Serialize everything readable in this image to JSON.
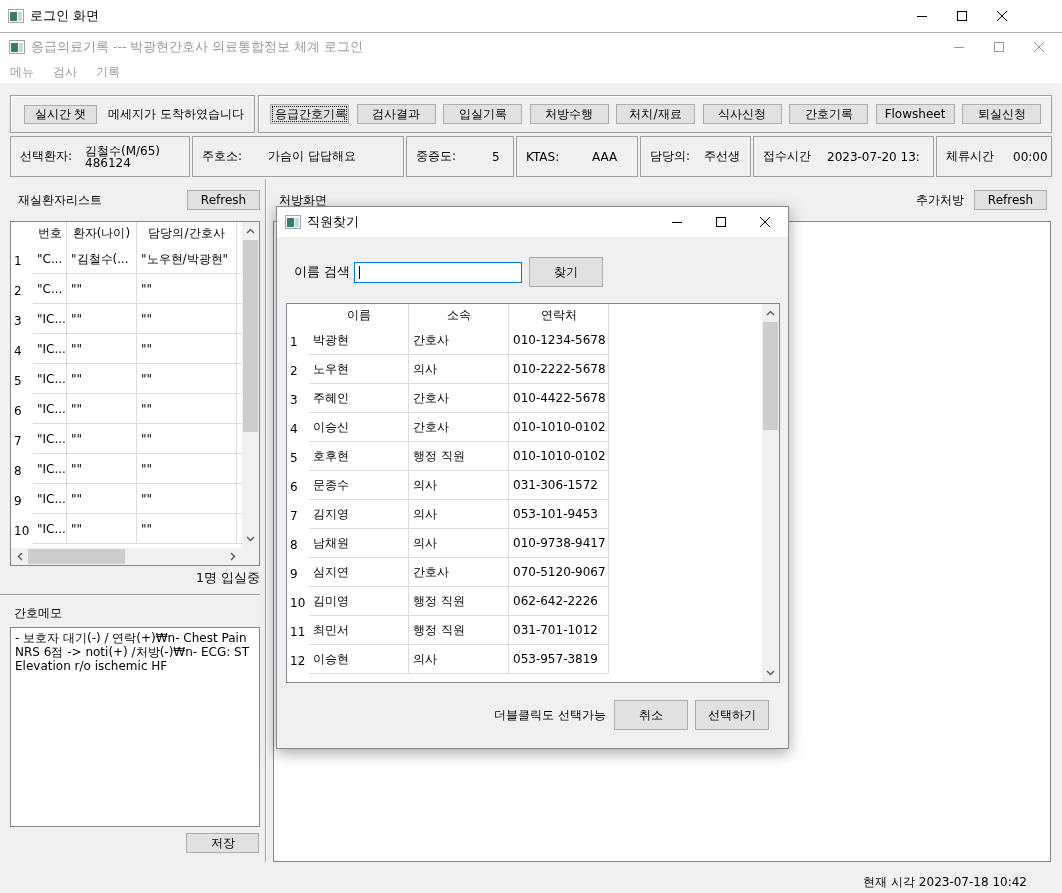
{
  "outer_window": {
    "title": "로그인 화면"
  },
  "window": {
    "title": "응급의료기록 --- 박광현간호사 의료통합정보 체계 로그인"
  },
  "menu": [
    {
      "label": "메뉴"
    },
    {
      "label": "검사"
    },
    {
      "label": "기록"
    }
  ],
  "chat": {
    "button": "실시간 챗",
    "message": "메세지가 도착하였습니다"
  },
  "toolbar": [
    {
      "label": "응급간호기록",
      "focused": true
    },
    {
      "label": "검사결과",
      "focused": false
    },
    {
      "label": "입실기록",
      "focused": false
    },
    {
      "label": "처방수행",
      "focused": false
    },
    {
      "label": "처치/재료",
      "focused": false
    },
    {
      "label": "식사신청",
      "focused": false
    },
    {
      "label": "간호기록",
      "focused": false
    },
    {
      "label": "Flowsheet",
      "focused": false
    },
    {
      "label": "퇴실신청",
      "focused": false
    }
  ],
  "patient_info": [
    {
      "label": "선택환자:",
      "value": "김철수(M/65)",
      "detail": "486124"
    },
    {
      "label": "주호소:",
      "value": "가슴이 답답해요"
    },
    {
      "label": "중증도:",
      "value": "5"
    },
    {
      "label": "KTAS:",
      "value": "AAA"
    },
    {
      "label": "담당의:",
      "value": "주선생"
    },
    {
      "label": "접수시간",
      "value": "2023-07-20 13:"
    },
    {
      "label": "체류시간",
      "value": "00:00"
    }
  ],
  "patient_list": {
    "title": "재실환자리스트",
    "refresh_button": "Refresh",
    "columns": [
      "번호",
      "환자(나이)",
      "담당의/간호사"
    ],
    "rows": [
      {
        "number": "1",
        "cells": [
          "\"C...",
          "\"김철수(...",
          "\"노우현/박광현\""
        ]
      },
      {
        "number": "2",
        "cells": [
          "\"C...",
          "\"\"",
          "\"\""
        ]
      },
      {
        "number": "3",
        "cells": [
          "\"IC...",
          "\"\"",
          "\"\""
        ]
      },
      {
        "number": "4",
        "cells": [
          "\"IC...",
          "\"\"",
          "\"\""
        ]
      },
      {
        "number": "5",
        "cells": [
          "\"IC...",
          "\"\"",
          "\"\""
        ]
      },
      {
        "number": "6",
        "cells": [
          "\"IC...",
          "\"\"",
          "\"\""
        ]
      },
      {
        "number": "7",
        "cells": [
          "\"IC...",
          "\"\"",
          "\"\""
        ]
      },
      {
        "number": "8",
        "cells": [
          "\"IC...",
          "\"\"",
          "\"\""
        ]
      },
      {
        "number": "9",
        "cells": [
          "\"IC...",
          "\"\"",
          "\"\""
        ]
      },
      {
        "number": "10",
        "cells": [
          "\"IC...",
          "\"\"",
          "\"\""
        ]
      }
    ],
    "status": "1명 입실중"
  },
  "nursing_memo": {
    "title": "간호메모",
    "text": "- 보호자 대기(-) / 연락(+)₩n- Chest Pain NRS 6점 -> noti(+) /처방(-)₩n- ECG: ST Elevation r/o ischemic HF",
    "save_button": "저장"
  },
  "prescription": {
    "title": "처방화면",
    "extra_label": "추가처방",
    "refresh_button": "Refresh"
  },
  "staff_dialog": {
    "title": "직원찾기",
    "search_label": "이름 검색",
    "search_focused": true,
    "search_button": "찾기",
    "columns": [
      "이름",
      "소속",
      "연락처"
    ],
    "rows": [
      {
        "number": "1",
        "cells": [
          "박광현",
          "간호사",
          "010-1234-5678"
        ]
      },
      {
        "number": "2",
        "cells": [
          "노우현",
          "의사",
          "010-2222-5678"
        ]
      },
      {
        "number": "3",
        "cells": [
          "주혜인",
          "간호사",
          "010-4422-5678"
        ]
      },
      {
        "number": "4",
        "cells": [
          "이승신",
          "간호사",
          "010-1010-0102"
        ]
      },
      {
        "number": "5",
        "cells": [
          "호후현",
          "행정 직원",
          "010-1010-0102"
        ]
      },
      {
        "number": "6",
        "cells": [
          "문종수",
          "의사",
          "031-306-1572"
        ]
      },
      {
        "number": "7",
        "cells": [
          "김지영",
          "의사",
          "053-101-9453"
        ]
      },
      {
        "number": "8",
        "cells": [
          "남채원",
          "의사",
          "010-9738-9417"
        ]
      },
      {
        "number": "9",
        "cells": [
          "심지연",
          "간호사",
          "070-5120-9067"
        ]
      },
      {
        "number": "10",
        "cells": [
          "김미영",
          "행정 직원",
          "062-642-2226"
        ]
      },
      {
        "number": "11",
        "cells": [
          "최민서",
          "행정 직원",
          "031-701-1012"
        ]
      },
      {
        "number": "12",
        "cells": [
          "이승현",
          "의사",
          "053-957-3819"
        ]
      }
    ],
    "hint": "더블클릭도 선택가능",
    "buttons": [
      "취소",
      "선택하기"
    ]
  },
  "status_bar": {
    "clock": "현재 시각 2023-07-18 10:42"
  }
}
